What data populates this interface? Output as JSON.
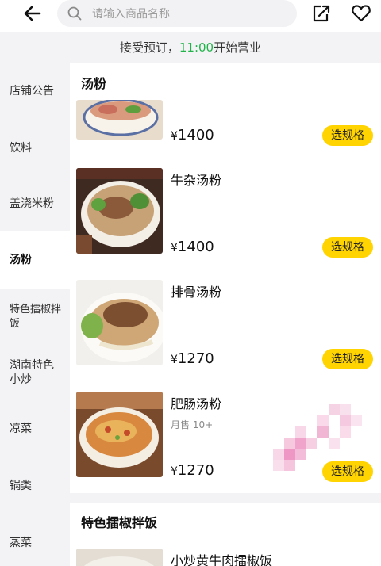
{
  "header": {
    "search_placeholder": "请输入商品名称",
    "back_icon": "arrow-left-icon",
    "share_icon": "share-icon",
    "favorite_icon": "heart-icon"
  },
  "notice": {
    "prefix": "接受预订，",
    "time": "11:00",
    "suffix": "开始营业",
    "time_color": "#21b34a"
  },
  "sidebar": {
    "items": [
      {
        "label": "店铺公告"
      },
      {
        "label": "饮料"
      },
      {
        "label": "盖浇米粉"
      },
      {
        "label": "汤粉"
      },
      {
        "label": "特色擂椒拌饭"
      },
      {
        "label": "湖南特色小炒"
      },
      {
        "label": "凉菜"
      },
      {
        "label": "锅类"
      },
      {
        "label": "蒸菜"
      }
    ]
  },
  "content": {
    "categories": [
      {
        "title": "汤粉"
      },
      {
        "title": "特色擂椒拌饭"
      }
    ],
    "products": [
      {
        "name": "",
        "price": "1400",
        "sales": "",
        "button": "选规格"
      },
      {
        "name": "牛杂汤粉",
        "price": "1400",
        "sales": "",
        "button": "选规格"
      },
      {
        "name": "排骨汤粉",
        "price": "1270",
        "sales": "",
        "button": "选规格"
      },
      {
        "name": "肥肠汤粉",
        "price": "1270",
        "sales": "月售 10+",
        "button": "选规格"
      },
      {
        "name": "小炒黄牛肉擂椒饭",
        "price": "",
        "sales": "",
        "button": ""
      }
    ],
    "currency": "¥",
    "accent": "#ffd400"
  }
}
